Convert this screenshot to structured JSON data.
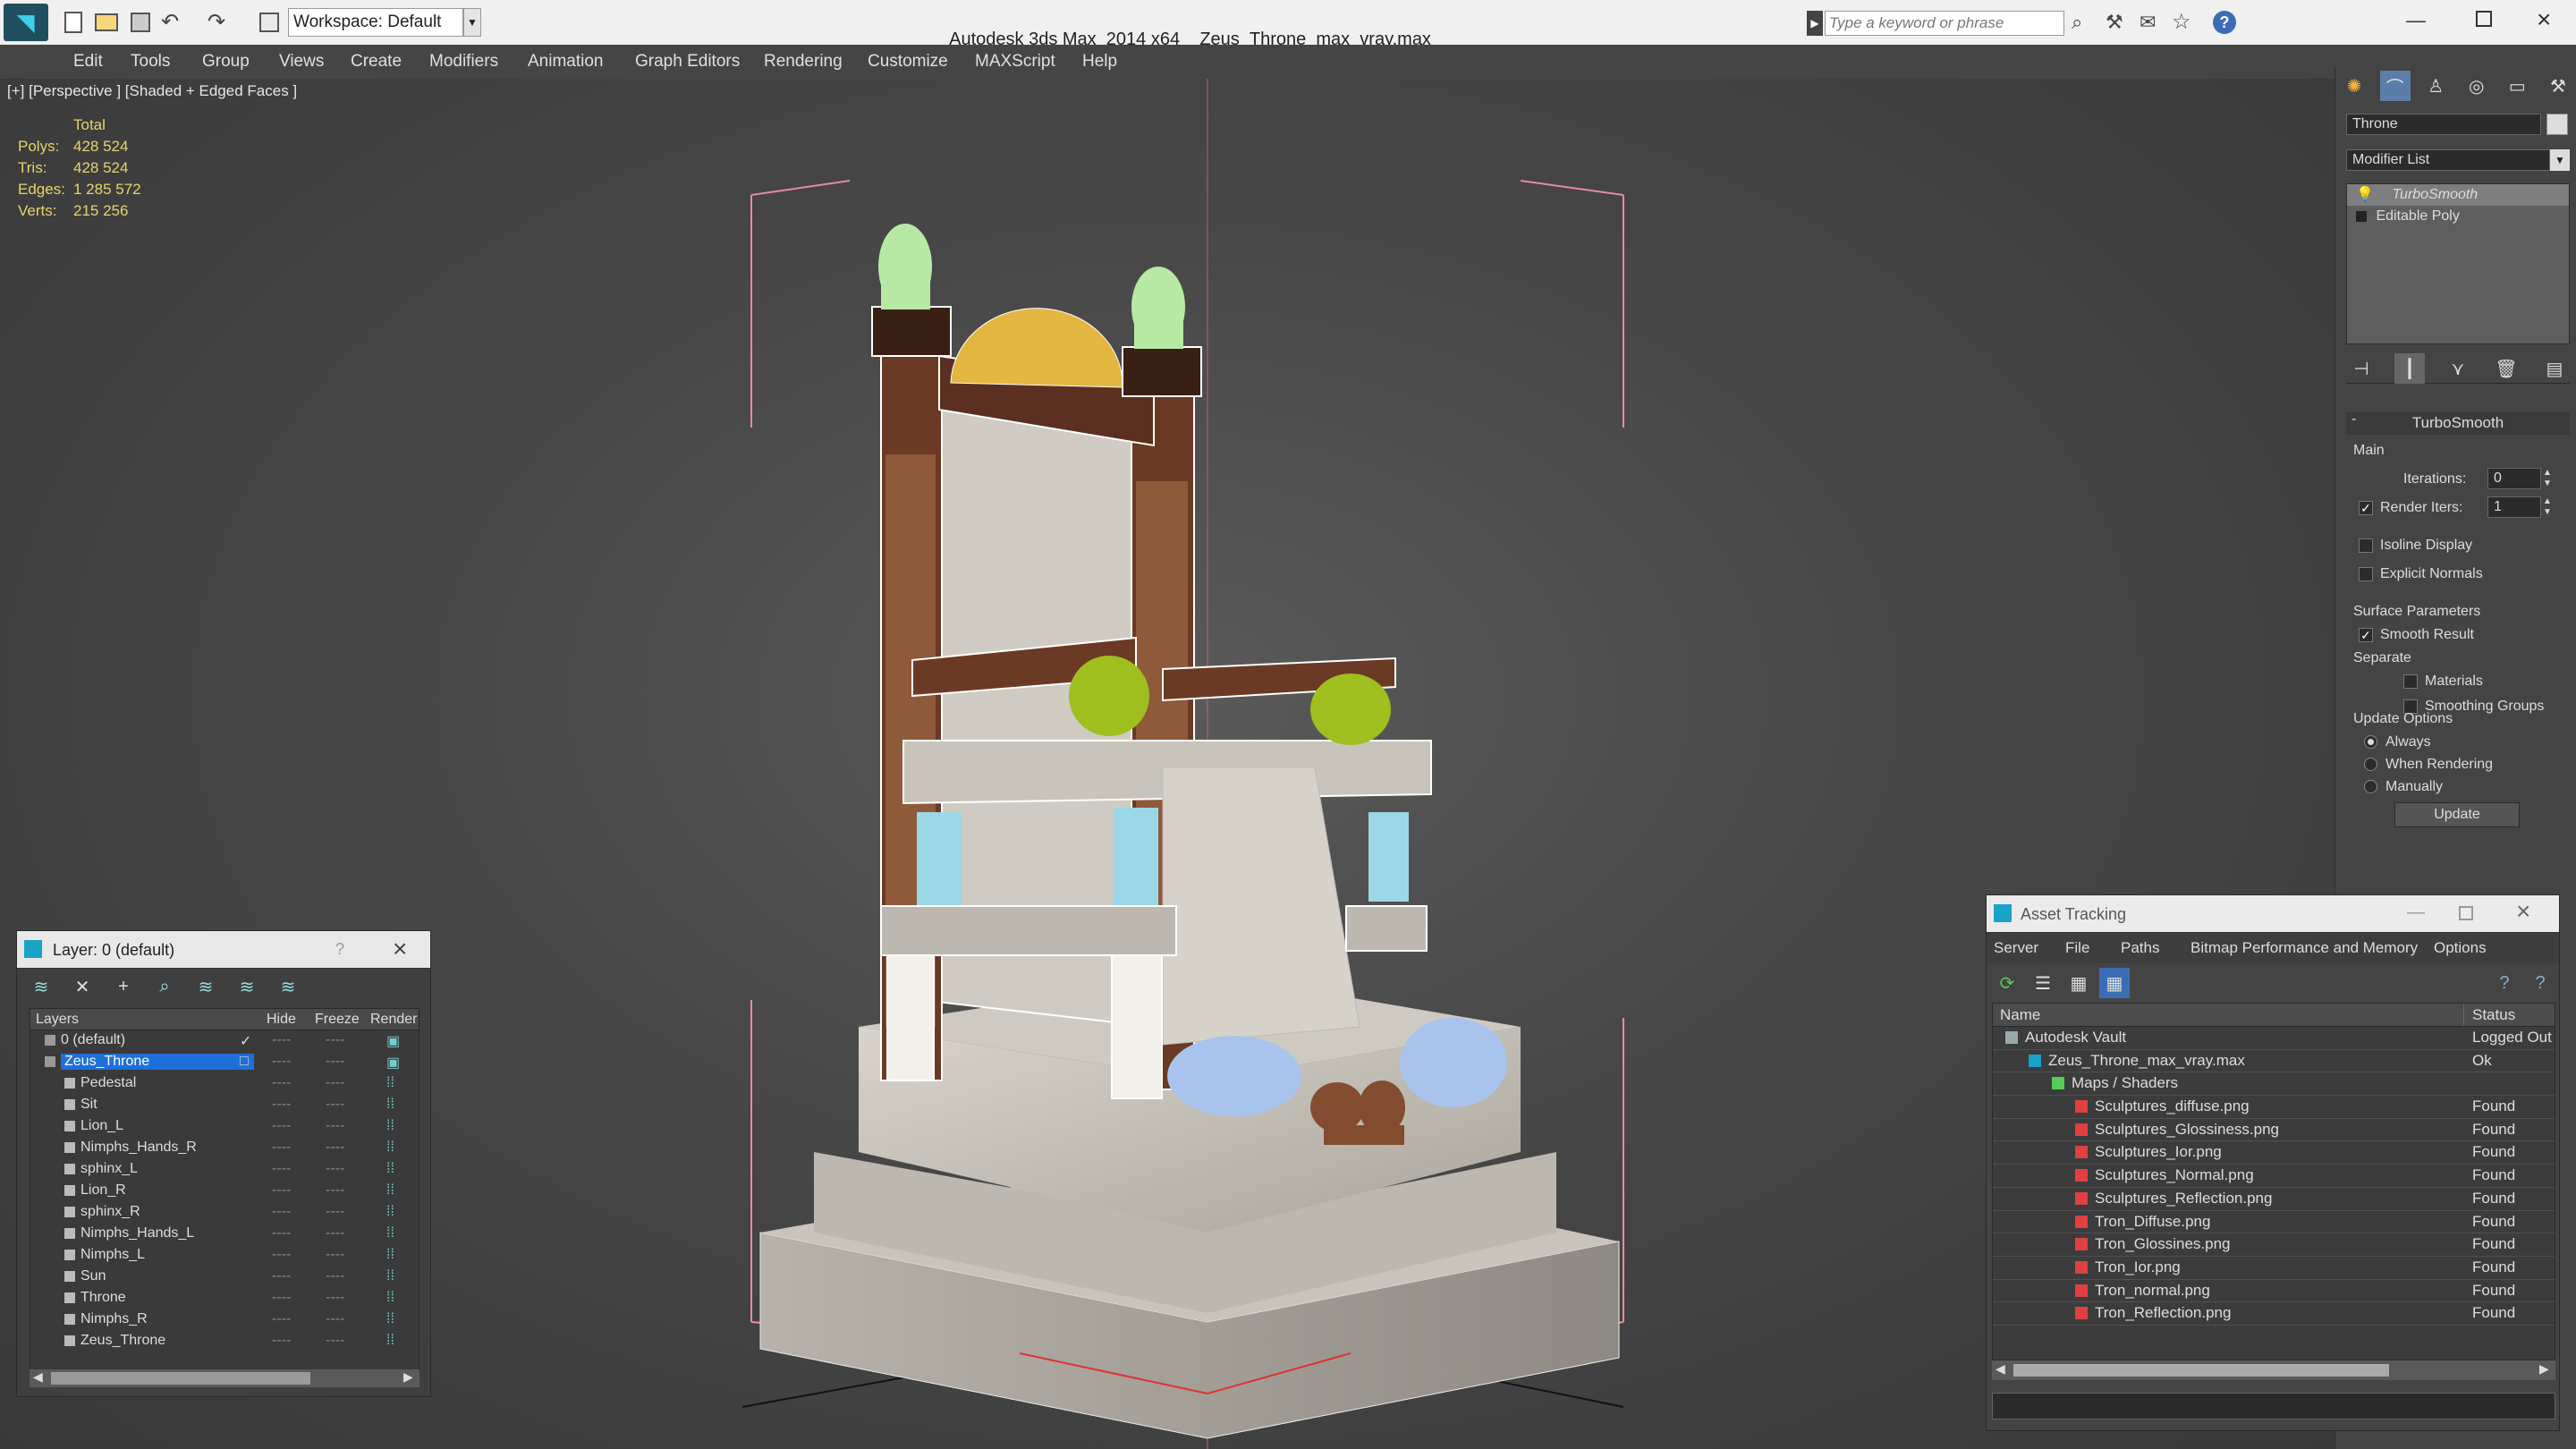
{
  "app": {
    "title": "Autodesk 3ds Max  2014 x64",
    "file": "Zeus_Throne_max_vray.max",
    "workspace": "Workspace: Default",
    "search_placeholder": "Type a keyword or phrase"
  },
  "menu": [
    "Edit",
    "Tools",
    "Group",
    "Views",
    "Create",
    "Modifiers",
    "Animation",
    "Graph Editors",
    "Rendering",
    "Customize",
    "MAXScript",
    "Help"
  ],
  "viewport": {
    "label": "[+] [Perspective ] [Shaded + Edged Faces ]",
    "stats": {
      "header": "Total",
      "rows": [
        {
          "k": "Polys:",
          "v": "428 524"
        },
        {
          "k": "Tris:",
          "v": "428 524"
        },
        {
          "k": "Edges:",
          "v": "1 285 572"
        },
        {
          "k": "Verts:",
          "v": "215 256"
        }
      ]
    }
  },
  "command_panel": {
    "object_name": "Throne",
    "modifier_list": "Modifier List",
    "stack": [
      "TurboSmooth",
      "Editable Poly"
    ],
    "rollout_title": "TurboSmooth",
    "main_label": "Main",
    "iterations_label": "Iterations:",
    "iterations_value": "0",
    "render_iters_label": "Render Iters:",
    "render_iters_value": "1",
    "isoline": "Isoline Display",
    "explicit": "Explicit Normals",
    "surface_label": "Surface Parameters",
    "smooth_result": "Smooth Result",
    "separate": "Separate",
    "materials": "Materials",
    "smoothing_groups": "Smoothing Groups",
    "update_options": "Update Options",
    "always": "Always",
    "when_rendering": "When Rendering",
    "manually": "Manually",
    "update_btn": "Update"
  },
  "layer_window": {
    "title": "Layer: 0 (default)",
    "help": "?",
    "columns": [
      "Layers",
      "Hide",
      "Freeze",
      "Render"
    ],
    "layers": [
      {
        "name": "0 (default)",
        "level": 0
      },
      {
        "name": "Zeus_Throne",
        "level": 0,
        "selected": true
      },
      {
        "name": "Pedestal",
        "level": 1
      },
      {
        "name": "Sit",
        "level": 1
      },
      {
        "name": "Lion_L",
        "level": 1
      },
      {
        "name": "Nimphs_Hands_R",
        "level": 1
      },
      {
        "name": "sphinx_L",
        "level": 1
      },
      {
        "name": "Lion_R",
        "level": 1
      },
      {
        "name": "sphinx_R",
        "level": 1
      },
      {
        "name": "Nimphs_Hands_L",
        "level": 1
      },
      {
        "name": "Nimphs_L",
        "level": 1
      },
      {
        "name": "Sun",
        "level": 1
      },
      {
        "name": "Throne",
        "level": 1
      },
      {
        "name": "Nimphs_R",
        "level": 1
      },
      {
        "name": "Zeus_Throne",
        "level": 1
      }
    ]
  },
  "asset_window": {
    "title": "Asset Tracking",
    "menu": [
      "Server",
      "File",
      "Paths",
      "Bitmap Performance and Memory",
      "Options"
    ],
    "columns": [
      "Name",
      "Status"
    ],
    "rows": [
      {
        "name": "Autodesk Vault",
        "status": "Logged Out",
        "level": 0
      },
      {
        "name": "Zeus_Throne_max_vray.max",
        "status": "Ok",
        "level": 1
      },
      {
        "name": "Maps / Shaders",
        "status": "",
        "level": 2
      },
      {
        "name": "Sculptures_diffuse.png",
        "status": "Found",
        "level": 3
      },
      {
        "name": "Sculptures_Glossiness.png",
        "status": "Found",
        "level": 3
      },
      {
        "name": "Sculptures_Ior.png",
        "status": "Found",
        "level": 3
      },
      {
        "name": "Sculptures_Normal.png",
        "status": "Found",
        "level": 3
      },
      {
        "name": "Sculptures_Reflection.png",
        "status": "Found",
        "level": 3
      },
      {
        "name": "Tron_Diffuse.png",
        "status": "Found",
        "level": 3
      },
      {
        "name": "Tron_Glossines.png",
        "status": "Found",
        "level": 3
      },
      {
        "name": "Tron_Ior.png",
        "status": "Found",
        "level": 3
      },
      {
        "name": "Tron_normal.png",
        "status": "Found",
        "level": 3
      },
      {
        "name": "Tron_Reflection.png",
        "status": "Found",
        "level": 3
      }
    ]
  },
  "colors": {
    "stats": "#e6d46a",
    "selection": "#1e6fd9",
    "accent": "#19a3c8"
  }
}
